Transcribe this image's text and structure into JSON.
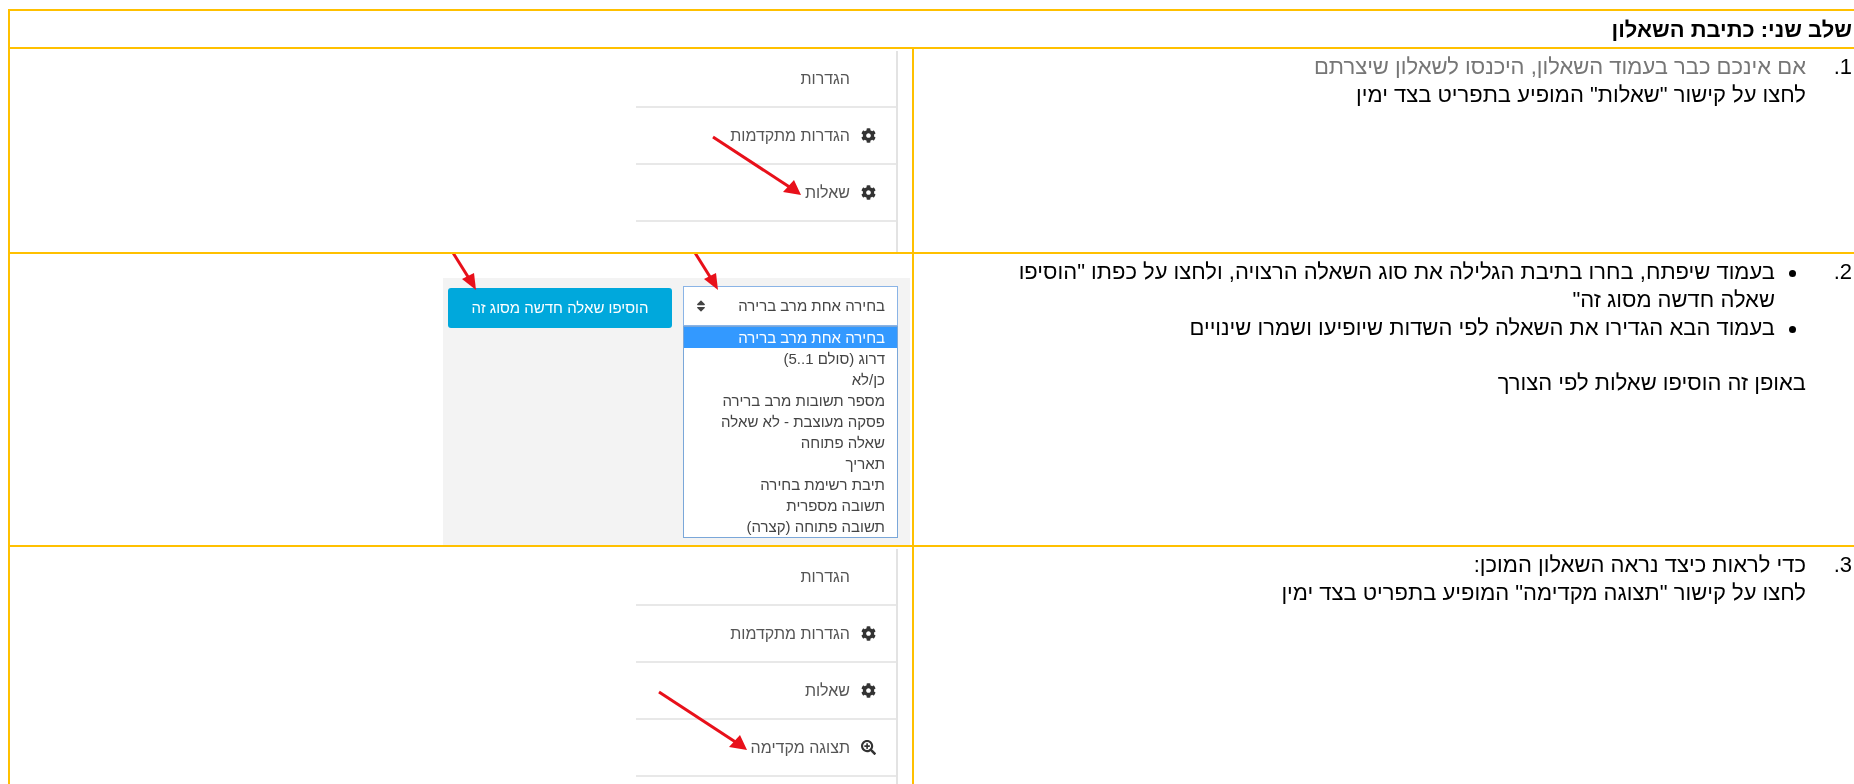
{
  "heading": "שלב שני: כתיבת השאלון",
  "steps": [
    {
      "number": "1.",
      "blocks": [
        {
          "kind": "line",
          "text": "אם אינכם כבר בעמוד השאלון, היכנסו לשאלון שיצרתם",
          "muted": true
        },
        {
          "kind": "line",
          "text": "לחצו על קישור \"שאלות\" המופיע בתפריט בצד ימין",
          "muted": false
        }
      ],
      "figure": {
        "kind": "menu",
        "items": [
          {
            "label": "הגדרות",
            "kind": "plain",
            "arrow": false
          },
          {
            "label": "הגדרות מתקדמות",
            "kind": "gear",
            "arrow": false
          },
          {
            "label": "שאלות",
            "kind": "gear",
            "arrow": true
          }
        ]
      }
    },
    {
      "number": "2.",
      "blocks": [
        {
          "kind": "bullet",
          "text": "בעמוד שיפתח, בחרו בתיבת הגלילה את סוג השאלה הרצויה, ולחצו על כפתו \"הוסיפו שאלה חדשה מסוג זה\""
        },
        {
          "kind": "bullet",
          "text": "בעמוד הבא הגדירו את השאלה לפי השדות שיופיעו ושמרו שינויים"
        },
        {
          "kind": "note",
          "text": "באופן זה הוסיפו שאלות לפי הצורך"
        }
      ],
      "figure": {
        "kind": "dropdown",
        "select": "בחירה אחת מרב ברירה",
        "button": "הוסיפו שאלה חדשה מסוג זה",
        "options": [
          {
            "label": "בחירה אחת מרב ברירה",
            "selected": true
          },
          {
            "label": "דרוג (סולם 1..5)",
            "selected": false
          },
          {
            "label": "כן/לא",
            "selected": false
          },
          {
            "label": "מספר תשובות מרב ברירה",
            "selected": false
          },
          {
            "label": "פסקה מעוצבת - לא שאלה",
            "selected": false
          },
          {
            "label": "שאלה פתוחה",
            "selected": false
          },
          {
            "label": "תאריך",
            "selected": false
          },
          {
            "label": "תיבת רשימת בחירה",
            "selected": false
          },
          {
            "label": "תשובה מספרית",
            "selected": false
          },
          {
            "label": "תשובה פתוחה (קצרה)",
            "selected": false
          }
        ]
      }
    },
    {
      "number": "3.",
      "blocks": [
        {
          "kind": "line",
          "text": "כדי לראות כיצד נראה השאלון המוכן:",
          "muted": false
        },
        {
          "kind": "line",
          "text": "לחצו על קישור \"תצוגה מקדימה\" המופיע בתפריט בצד ימין",
          "muted": false
        }
      ],
      "figure": {
        "kind": "menu",
        "items": [
          {
            "label": "הגדרות",
            "kind": "plain",
            "arrow": false
          },
          {
            "label": "הגדרות מתקדמות",
            "kind": "gear",
            "arrow": false
          },
          {
            "label": "שאלות",
            "kind": "gear",
            "arrow": false
          },
          {
            "label": "תצוגה מקדימה",
            "kind": "zoom",
            "arrow": true
          }
        ]
      }
    }
  ]
}
